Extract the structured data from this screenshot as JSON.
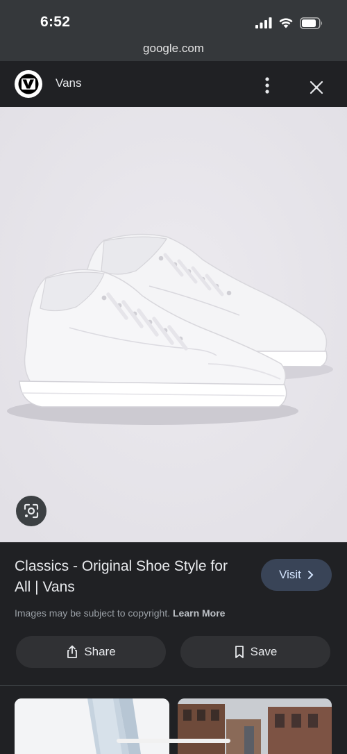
{
  "status_bar": {
    "time": "6:52",
    "icons": [
      "signal-bars-icon",
      "wifi-icon",
      "battery-icon"
    ]
  },
  "browser": {
    "url": "google.com"
  },
  "header": {
    "site_name": "Vans",
    "icons": [
      "vans-logo-icon",
      "more-vertical-icon",
      "close-icon"
    ]
  },
  "image": {
    "subject": "pair of white canvas low-top sneakers",
    "lens_icon": "google-lens-icon"
  },
  "result": {
    "title": "Classics - Original Shoe Style for All | Vans",
    "visit_label": "Visit",
    "copyright_text": "Images may be subject to copyright.",
    "learn_more_label": "Learn More",
    "share_label": "Share",
    "save_label": "Save"
  },
  "colors": {
    "page_background": "#202124",
    "status_bar": "#35383b",
    "visit_button": "#394457",
    "action_button": "#303134",
    "image_background": "#e6e4e9"
  }
}
